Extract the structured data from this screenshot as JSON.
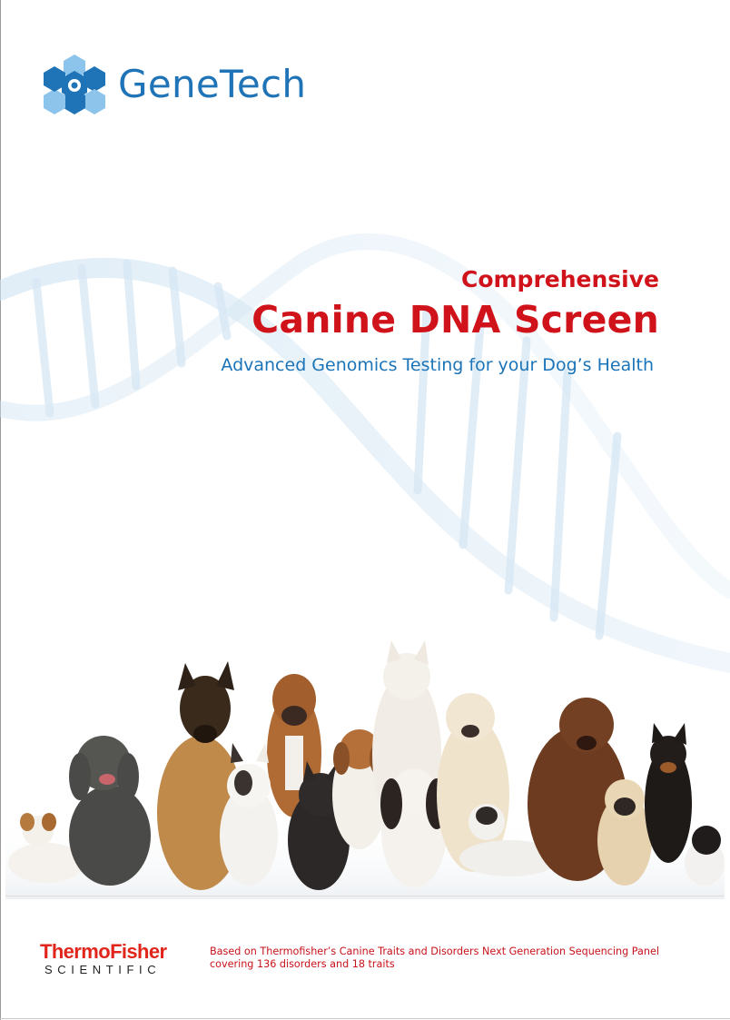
{
  "brand": {
    "name": "GeneTech",
    "colors": {
      "blue": "#1f73b7",
      "light_blue": "#8cc4ec",
      "red": "#d0121b"
    }
  },
  "cover": {
    "subtitle": "Comprehensive",
    "title": "Canine DNA Screen",
    "tagline": "Advanced Genomics Testing for your Dog’s Health"
  },
  "images": {
    "background": "dna-helix",
    "photo": "group-of-dogs"
  },
  "footer": {
    "partner_logo_top": "ThermoFisher",
    "partner_logo_bottom": "SCIENTIFIC",
    "note_line1": "Based on Thermofisher’s Canine Traits and Disorders Next Generation Sequencing Panel",
    "note_line2": "covering 136 disorders and 18 traits"
  }
}
